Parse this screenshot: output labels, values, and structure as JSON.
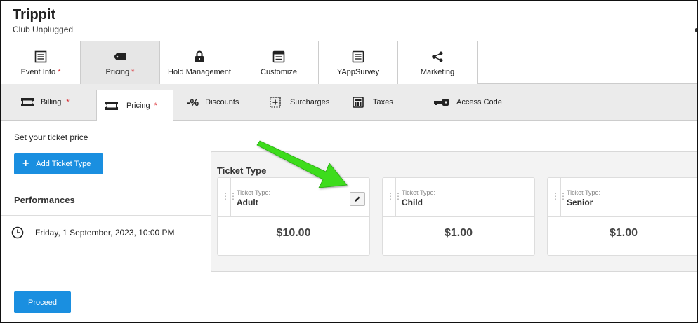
{
  "header": {
    "title": "Trippit",
    "subtitle": "Club Unplugged"
  },
  "top_tabs": [
    {
      "label": "Event Info",
      "required": "*",
      "icon": "list-icon"
    },
    {
      "label": "Pricing",
      "required": "*",
      "icon": "ticket-tag-icon"
    },
    {
      "label": "Hold Management",
      "icon": "lock-icon"
    },
    {
      "label": "Customize",
      "icon": "layout-icon"
    },
    {
      "label": "YAppSurvey",
      "icon": "survey-list-icon"
    },
    {
      "label": "Marketing",
      "icon": "share-icon"
    }
  ],
  "sub_tabs": [
    {
      "label": "Billing",
      "required": "*",
      "icon": "ticket-icon"
    },
    {
      "label": "Pricing",
      "required": "*",
      "icon": "ticket-icon"
    },
    {
      "label": "Discounts",
      "icon_text": "-%"
    },
    {
      "label": "Surcharges",
      "icon": "plus-box-icon"
    },
    {
      "label": "Taxes",
      "icon": "calculator-icon"
    },
    {
      "label": "Access Code",
      "icon": "key-icon"
    }
  ],
  "main": {
    "set_price_label": "Set your ticket price",
    "add_ticket_type_label": "Add Ticket Type",
    "performances_title": "Performances",
    "performance_date": "Friday, 1 September, 2023, 10:00 PM",
    "ticket_type_title": "Ticket Type",
    "ticket_type_field_label": "Ticket Type:",
    "tickets": [
      {
        "name": "Adult",
        "price": "$10.00"
      },
      {
        "name": "Child",
        "price": "$1.00"
      },
      {
        "name": "Senior",
        "price": "$1.00"
      }
    ],
    "proceed_label": "Proceed"
  },
  "colors": {
    "primary_button": "#1a8fe0",
    "required_marker": "#d9262c",
    "annotation_arrow": "#3ddc1f"
  }
}
